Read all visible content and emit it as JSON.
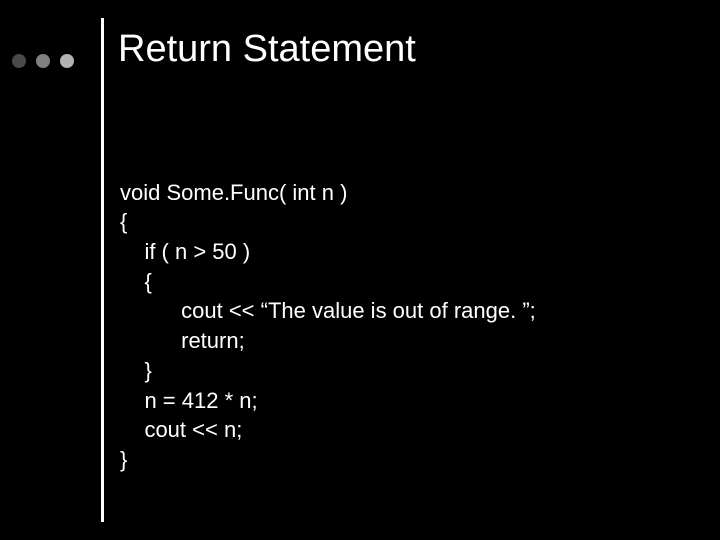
{
  "title": "Return Statement",
  "code": {
    "l0": "void Some.Func( int n )",
    "l1": "{",
    "l2": "    if ( n > 50 )",
    "l3": "    {",
    "l4": "          cout << “The value is out of range. ”;",
    "l5": "          return;",
    "l6": "    }",
    "l7": "    n = 412 * n;",
    "l8": "    cout << n;",
    "l9": "}"
  }
}
